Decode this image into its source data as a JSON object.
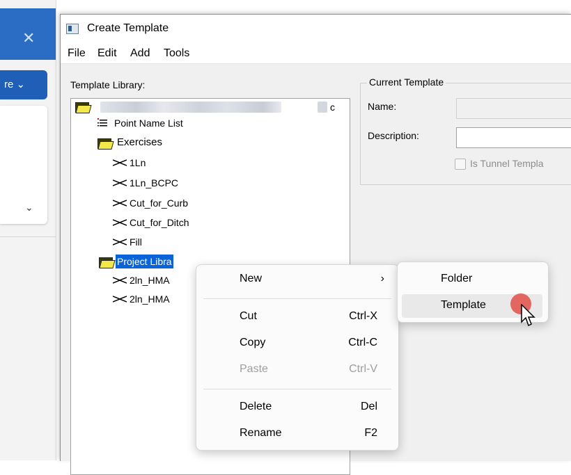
{
  "background_app": {
    "close_glyph": "✕",
    "blue_button_label": "re ⌄",
    "chevron_glyph": "⌄"
  },
  "dialog": {
    "title": "Create Template",
    "menu": [
      "File",
      "Edit",
      "Add",
      "Tools"
    ]
  },
  "library": {
    "label": "Template Library:",
    "root_suffix": "c",
    "items": {
      "point_name_list": "Point Name List",
      "exercises": "Exercises",
      "t1": "1Ln",
      "t2": "1Ln_BCPC",
      "t3": "Cut_for_Curb",
      "t4": "Cut_for_Ditch",
      "t5": "Fill",
      "project_library": "Project Libra",
      "p1": "2ln_HMA",
      "p2": "2ln_HMA"
    }
  },
  "current_template": {
    "legend": "Current Template",
    "name_label": "Name:",
    "description_label": "Description:",
    "tunnel_label": "Is Tunnel Templa"
  },
  "context_menu": {
    "new": "New",
    "new_arrow": "›",
    "cut": "Cut",
    "cut_sc": "Ctrl-X",
    "copy": "Copy",
    "copy_sc": "Ctrl-C",
    "paste": "Paste",
    "paste_sc": "Ctrl-V",
    "delete": "Delete",
    "delete_sc": "Del",
    "rename": "Rename",
    "rename_sc": "F2"
  },
  "submenu": {
    "folder": "Folder",
    "template": "Template"
  },
  "colors": {
    "selection": "#0a64d8",
    "titlebar_blue": "#2b6cc4",
    "cursor_highlight": "#e35a55"
  }
}
